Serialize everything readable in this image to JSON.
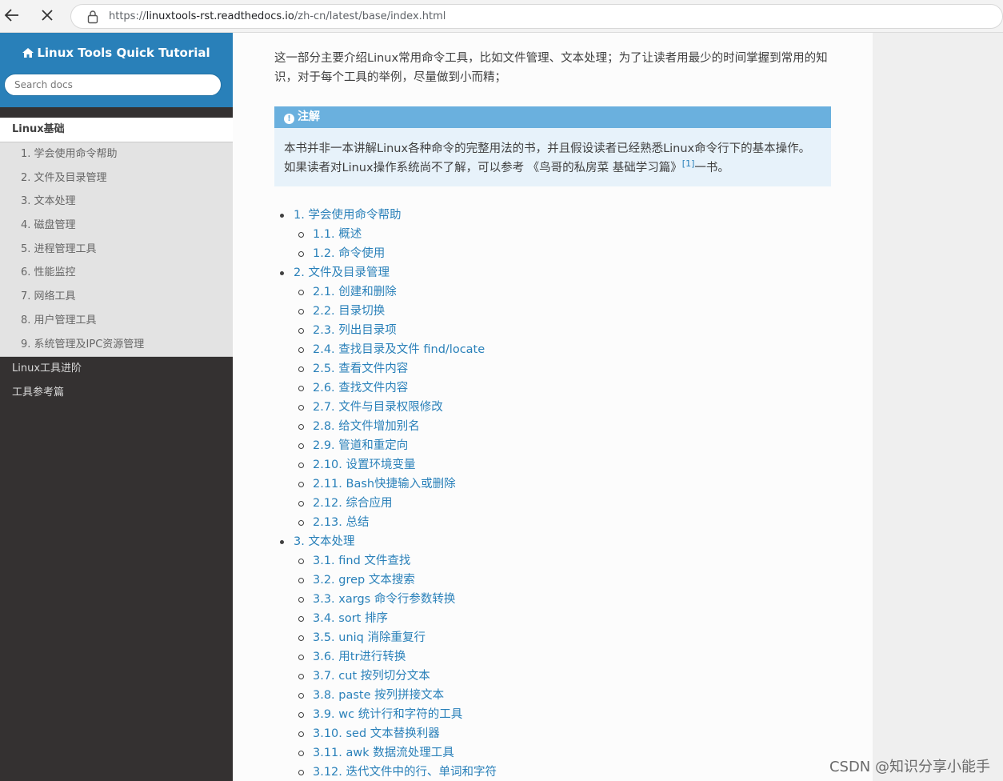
{
  "browser": {
    "url_prefix": "https://",
    "url_host": "linuxtools-rst.readthedocs.io",
    "url_path": "/zh-cn/latest/base/index.html"
  },
  "sidebar": {
    "brand": "Linux Tools Quick Tutorial",
    "search_placeholder": "Search docs",
    "current_section": "Linux基础",
    "sub_items": [
      "1. 学会使用命令帮助",
      "2. 文件及目录管理",
      "3. 文本处理",
      "4. 磁盘管理",
      "5. 进程管理工具",
      "6. 性能监控",
      "7. 网络工具",
      "8. 用户管理工具",
      "9. 系统管理及IPC资源管理"
    ],
    "other_sections": [
      "Linux工具进阶",
      "工具参考篇"
    ]
  },
  "main": {
    "intro": "这一部分主要介绍Linux常用命令工具，比如文件管理、文本处理；为了让读者用最少的时间掌握到常用的知识，对于每个工具的举例，尽量做到小而精；",
    "note": {
      "title": "注解",
      "body_before": "本书并非一本讲解Linux各种命令的完整用法的书，并且假设读者已经熟悉Linux命令行下的基本操作。如果读者对Linux操作系统尚不了解，可以参考 《鸟哥的私房菜 基础学习篇》",
      "footnote": "[1]",
      "body_after": "一书。"
    },
    "toc": [
      {
        "level": 1,
        "text": "1. 学会使用命令帮助"
      },
      {
        "level": 2,
        "text": "1.1. 概述"
      },
      {
        "level": 2,
        "text": "1.2. 命令使用"
      },
      {
        "level": 1,
        "text": "2. 文件及目录管理"
      },
      {
        "level": 2,
        "text": "2.1. 创建和删除"
      },
      {
        "level": 2,
        "text": "2.2. 目录切换"
      },
      {
        "level": 2,
        "text": "2.3. 列出目录项"
      },
      {
        "level": 2,
        "text": "2.4. 查找目录及文件 find/locate"
      },
      {
        "level": 2,
        "text": "2.5. 查看文件内容"
      },
      {
        "level": 2,
        "text": "2.6. 查找文件内容"
      },
      {
        "level": 2,
        "text": "2.7. 文件与目录权限修改"
      },
      {
        "level": 2,
        "text": "2.8. 给文件增加别名"
      },
      {
        "level": 2,
        "text": "2.9. 管道和重定向"
      },
      {
        "level": 2,
        "text": "2.10. 设置环境变量"
      },
      {
        "level": 2,
        "text": "2.11. Bash快捷输入或删除"
      },
      {
        "level": 2,
        "text": "2.12. 综合应用"
      },
      {
        "level": 2,
        "text": "2.13. 总结"
      },
      {
        "level": 1,
        "text": "3. 文本处理"
      },
      {
        "level": 2,
        "text": "3.1. find 文件查找"
      },
      {
        "level": 2,
        "text": "3.2. grep 文本搜索"
      },
      {
        "level": 2,
        "text": "3.3. xargs 命令行参数转换"
      },
      {
        "level": 2,
        "text": "3.4. sort 排序"
      },
      {
        "level": 2,
        "text": "3.5. uniq 消除重复行"
      },
      {
        "level": 2,
        "text": "3.6. 用tr进行转换"
      },
      {
        "level": 2,
        "text": "3.7. cut 按列切分文本"
      },
      {
        "level": 2,
        "text": "3.8. paste 按列拼接文本"
      },
      {
        "level": 2,
        "text": "3.9. wc 统计行和字符的工具"
      },
      {
        "level": 2,
        "text": "3.10. sed 文本替换利器"
      },
      {
        "level": 2,
        "text": "3.11. awk 数据流处理工具"
      },
      {
        "level": 2,
        "text": "3.12. 迭代文件中的行、单词和字符"
      }
    ]
  },
  "watermark": "CSDN @知识分享小能手",
  "colors": {
    "accent": "#2980b9",
    "sidebar_bg": "#343131",
    "note_title_bg": "#6ab0de",
    "note_body_bg": "#e7f2fa"
  }
}
